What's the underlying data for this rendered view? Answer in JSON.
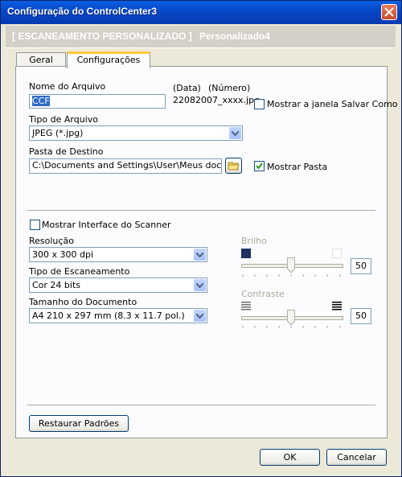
{
  "window": {
    "title": "Configuração do ControlCenter3"
  },
  "header": {
    "mode": "[ ESCANEAMENTO PERSONALIZADO ]",
    "profile": "Personalizado4"
  },
  "tabs": [
    {
      "label": "Geral"
    },
    {
      "label": "Configurações"
    }
  ],
  "file": {
    "name_label": "Nome do Arquivo",
    "name_value": "CCF",
    "data_label": "(Data)",
    "numero_label": "(Número)",
    "sample_name": "22082007_xxxx.jpg",
    "show_save_as_label": "Mostrar a janela Salvar Como"
  },
  "file_type": {
    "label": "Tipo de Arquivo",
    "value": "JPEG (*.jpg)"
  },
  "destination": {
    "label": "Pasta de Destino",
    "value": "C:\\Documents and Settings\\User\\Meus documentos\\",
    "show_folder_label": "Mostrar Pasta",
    "show_folder_checked": true
  },
  "scanner": {
    "show_interface_label": "Mostrar Interface do Scanner",
    "show_interface_checked": false,
    "resolution_label": "Resolução",
    "resolution_value": "300 x 300 dpi",
    "scan_type_label": "Tipo de Escaneamento",
    "scan_type_value": "Cor 24 bits",
    "doc_size_label": "Tamanho do Documento",
    "doc_size_value": "A4 210 x 297 mm (8.3 x 11.7 pol.)"
  },
  "brightness": {
    "label": "Brilho",
    "value": "50"
  },
  "contrast": {
    "label": "Contraste",
    "value": "50"
  },
  "buttons": {
    "restore": "Restaurar Padrões",
    "ok": "OK",
    "cancel": "Cancelar"
  },
  "colors": {
    "titlebar": "#0846C8",
    "header": "#D4D0C8",
    "selection": "#316AC5"
  },
  "icons": {
    "close": "close-icon",
    "folder": "folder-icon",
    "dropdown": "chevron-down-icon"
  }
}
